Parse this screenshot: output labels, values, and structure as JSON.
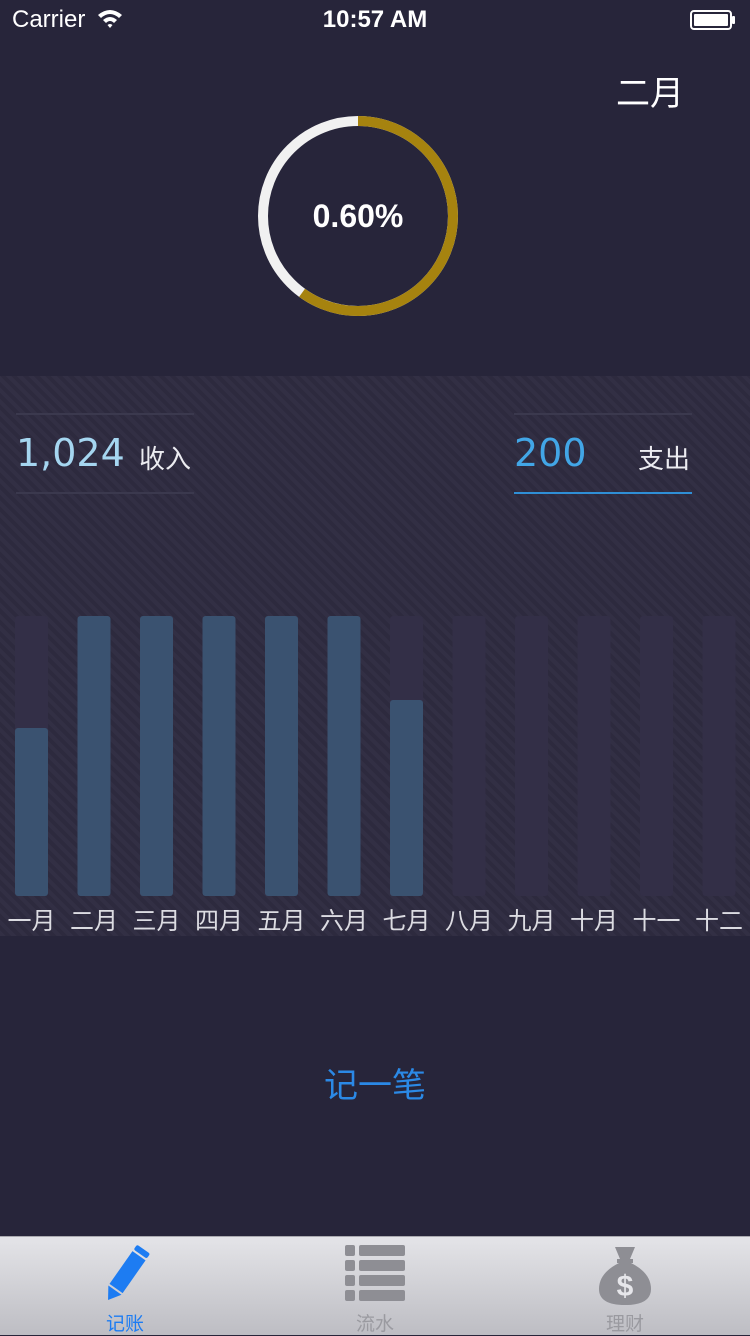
{
  "status_bar": {
    "carrier": "Carrier",
    "time": "10:57 AM"
  },
  "header": {
    "month": "二月"
  },
  "progress": {
    "label": "0.60%",
    "fraction": 0.6,
    "colors": {
      "filled": "#a6830f",
      "remaining": "#f1f1f1"
    }
  },
  "summary": {
    "income": {
      "value": "1,024",
      "label": "收入"
    },
    "expense": {
      "value": "200",
      "label": "支出"
    }
  },
  "chart_data": {
    "type": "bar",
    "categories": [
      "一月",
      "二月",
      "三月",
      "四月",
      "五月",
      "六月",
      "七月",
      "八月",
      "九月",
      "十月",
      "十一",
      "十二"
    ],
    "values": [
      60,
      100,
      100,
      100,
      100,
      100,
      70,
      0,
      0,
      0,
      0,
      0
    ],
    "ylim": [
      0,
      100
    ],
    "colors": {
      "bar": "#3a5270",
      "track": "#332f47",
      "label": "#dcdce2"
    }
  },
  "actions": {
    "record": "记一笔"
  },
  "tab_bar": {
    "items": [
      {
        "label": "记账",
        "icon": "pencil-icon",
        "active": true
      },
      {
        "label": "流水",
        "icon": "list-icon",
        "active": false
      },
      {
        "label": "理财",
        "icon": "money-bag-icon",
        "active": false
      }
    ]
  }
}
